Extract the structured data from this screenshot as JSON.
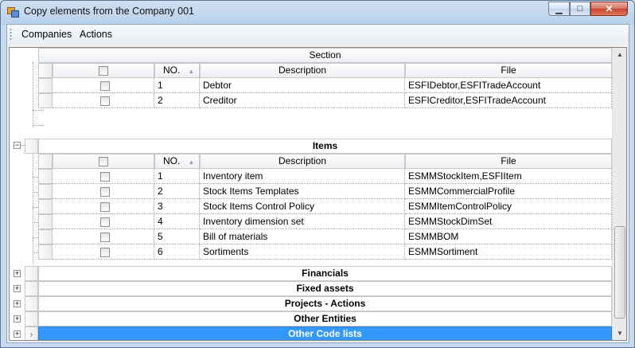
{
  "window": {
    "title": "Copy elements from the Company 001",
    "buttons": {
      "minimize": "▁",
      "maximize": "□",
      "close": "✕"
    }
  },
  "menu": [
    "Companies",
    "Actions"
  ],
  "grid": {
    "section_header": "Section",
    "columns": {
      "no": "NO.",
      "description": "Description",
      "file": "File"
    },
    "first_group_rows": [
      {
        "no": "1",
        "description": "Debtor",
        "file": "ESFIDebtor,ESFITradeAccount"
      },
      {
        "no": "2",
        "description": "Creditor",
        "file": "ESFICreditor,ESFITradeAccount"
      }
    ],
    "items_group": {
      "title": "Items",
      "rows": [
        {
          "no": "1",
          "description": "Inventory item",
          "file": "ESMMStockItem,ESFIItem"
        },
        {
          "no": "2",
          "description": "Stock Items Templates",
          "file": "ESMMCommercialProfile"
        },
        {
          "no": "3",
          "description": "Stock Items Control Policy",
          "file": "ESMMItemControlPolicy"
        },
        {
          "no": "4",
          "description": "Inventory dimension set",
          "file": "ESMMStockDimSet"
        },
        {
          "no": "5",
          "description": "Bill of materials",
          "file": "ESMMBOM"
        },
        {
          "no": "6",
          "description": "Sortiments",
          "file": "ESMMSortiment"
        }
      ]
    },
    "collapsed_groups": [
      "Financials",
      "Fixed assets",
      "Projects - Actions",
      "Other Entities",
      "Other Code lists"
    ],
    "selected_group": "Other Code lists"
  }
}
